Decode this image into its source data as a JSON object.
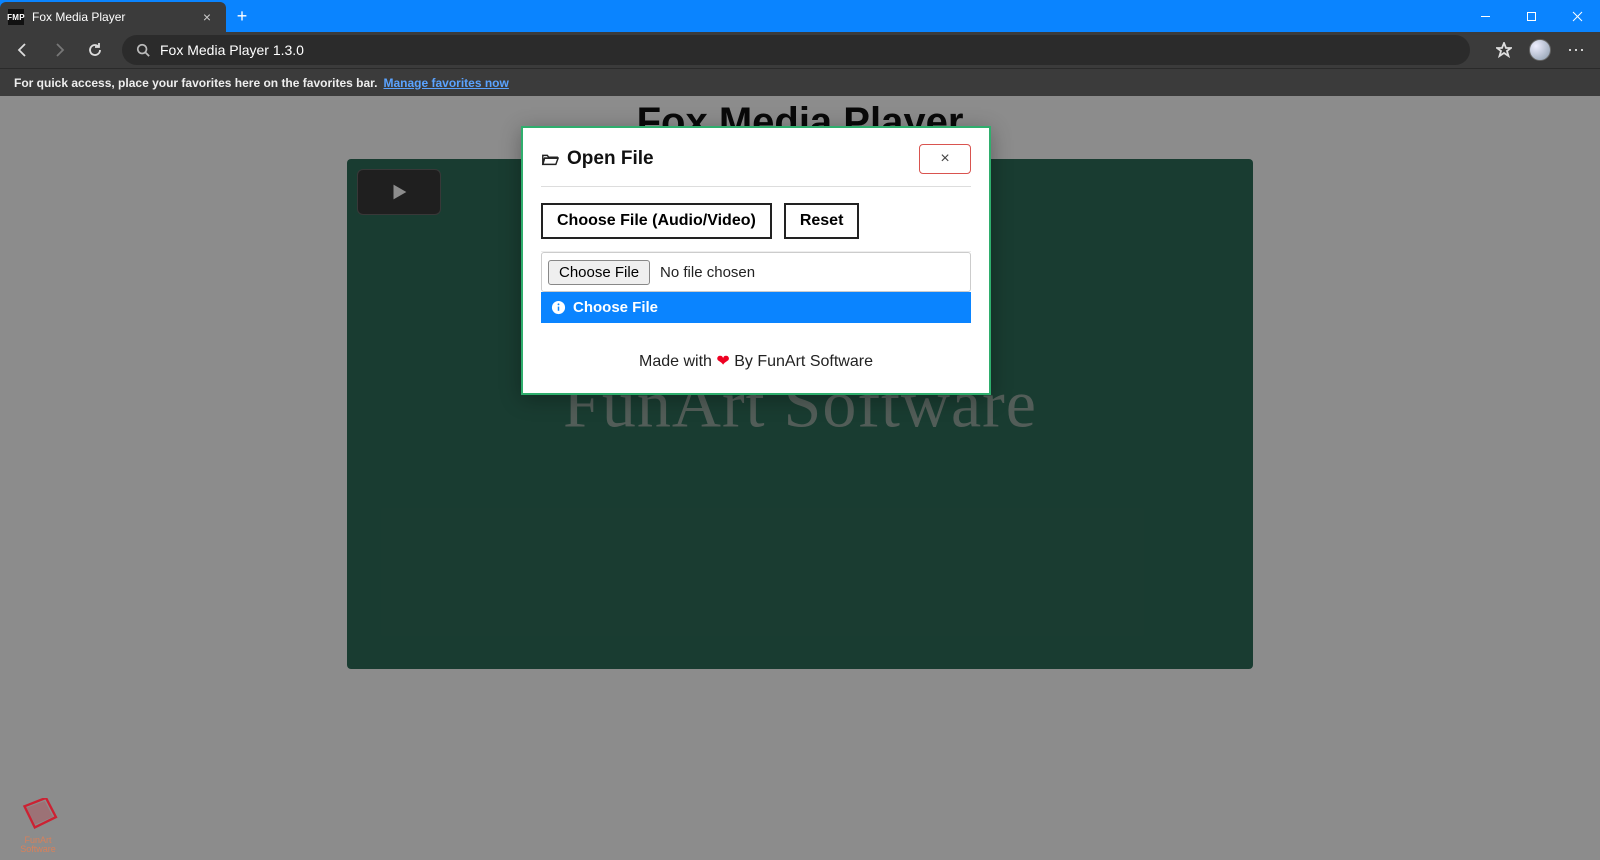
{
  "browser": {
    "tab_title": "Fox Media Player",
    "tab_favicon_text": "FMP",
    "omnibox_text": "Fox Media Player 1.3.0",
    "favorites_hint": "For quick access, place your favorites here on the favorites bar.",
    "manage_favorites_link": "Manage favorites now"
  },
  "page": {
    "title": "Fox Media Player",
    "watermark": "FunArt Software"
  },
  "modal": {
    "title": "Open File",
    "choose_file_av_btn": "Choose File (Audio/Video)",
    "reset_btn": "Reset",
    "native_choose_btn": "Choose File",
    "native_choose_status": "No file chosen",
    "banner_text": "Choose File",
    "credit_prefix": "Made with ",
    "credit_suffix": " By FunArt Software",
    "close_glyph": "×"
  },
  "corner_logo": {
    "line1": "FunArt",
    "line2": "Software"
  }
}
